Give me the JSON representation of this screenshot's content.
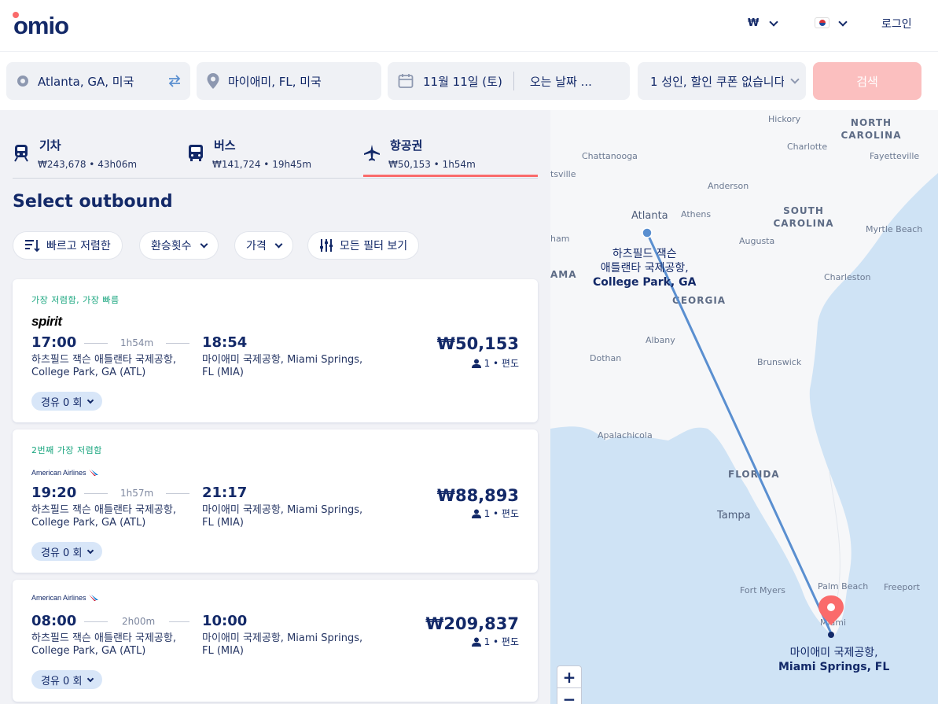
{
  "header": {
    "logo": "omio",
    "currency": "₩",
    "login": "로그인",
    "colors": {
      "brand": "#132968",
      "accent": "#fa6b6b"
    }
  },
  "search": {
    "origin": "Atlanta, GA, 미국",
    "destination": "마이애미, FL, 미국",
    "depart_date": "11월 11일 (토)",
    "return_date": "오는 날짜 ...",
    "passengers": "1 성인, 할인 쿠폰 없습니다",
    "search_button": "검색",
    "icons": [
      "origin-circle-icon",
      "swap-icon",
      "location-pin-icon",
      "calendar-icon",
      "chevron-down-icon"
    ]
  },
  "modes": [
    {
      "name": "기차",
      "info": "₩243,678 • 43h06m",
      "icon": "train-icon"
    },
    {
      "name": "버스",
      "info": "₩141,724 • 19h45m",
      "icon": "bus-icon"
    },
    {
      "name": "항공권",
      "info": "₩50,153 • 1h54m",
      "icon": "plane-icon",
      "active": true
    }
  ],
  "page_title": "Select outbound",
  "filters": {
    "sort": "빠르고 저렴한",
    "transfers": "환승횟수",
    "price": "가격",
    "all_filters": "모든 필터 보기"
  },
  "results": [
    {
      "tag": "가장 저렴함, 가장 빠름",
      "airline": "spirit",
      "dep_time": "17:00",
      "duration": "1h54m",
      "arr_time": "18:54",
      "dep_airport": "하츠필드 잭슨 애틀랜타 국제공항, College Park, GA (ATL)",
      "arr_airport": "마이애미 국제공항, Miami Springs, FL (MIA)",
      "price": "₩50,153",
      "pax": "1 • 편도",
      "stops": "경유 0 회"
    },
    {
      "tag": "2번째 가장 저렴함",
      "airline": "American Airlines",
      "dep_time": "19:20",
      "duration": "1h57m",
      "arr_time": "21:17",
      "dep_airport": "하츠필드 잭슨 애틀랜타 국제공항, College Park, GA (ATL)",
      "arr_airport": "마이애미 국제공항, Miami Springs, FL (MIA)",
      "price": "₩88,893",
      "pax": "1 • 편도",
      "stops": "경유 0 회"
    },
    {
      "tag": "",
      "airline": "American Airlines",
      "dep_time": "08:00",
      "duration": "2h00m",
      "arr_time": "10:00",
      "dep_airport": "하츠필드 잭슨 애틀랜타 국제공항, College Park, GA (ATL)",
      "arr_airport": "마이애미 국제공항, Miami Springs, FL (MIA)",
      "price": "₩209,837",
      "pax": "1 • 편도",
      "stops": "경유 0 회"
    }
  ],
  "map": {
    "states": [
      "NORTH CAROLINA",
      "SOUTH CAROLINA",
      "GEORGIA",
      "FLORIDA",
      "AMA"
    ],
    "cities": [
      "Hickory",
      "Charlotte",
      "Fayetteville",
      "Chattanooga",
      "Anderson",
      "Atlanta",
      "Athens",
      "Augusta",
      "Myrtle Beach",
      "Charleston",
      "Albany",
      "Dothan",
      "Brunswick",
      "Apalachicola",
      "Tampa",
      "Fort Myers",
      "Palm Beach",
      "Freeport",
      "Miami",
      "tsville",
      "ham"
    ],
    "origin_airport_line1": "하츠필드 잭슨",
    "origin_airport_line2": "애틀랜타 국제공항,",
    "origin_airport_line3": "College Park, GA",
    "dest_airport_line1": "마이애미 국제공항,",
    "dest_airport_line2": "Miami Springs, FL",
    "zoom_in": "+",
    "zoom_out": "−"
  }
}
